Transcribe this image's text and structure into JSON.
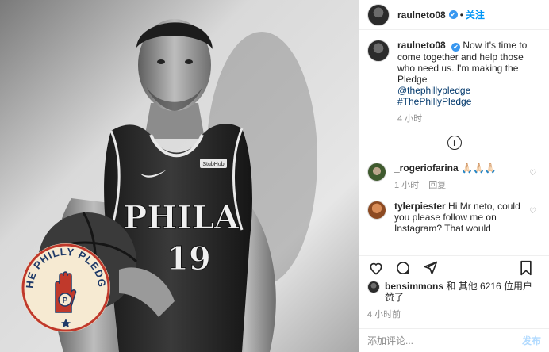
{
  "header": {
    "username": "raulneto08",
    "verified_mark": "✔",
    "separator": "•",
    "follow_label": "关注"
  },
  "caption": {
    "username": "raulneto08",
    "text": "Now it's time to come together and help those who need us. I'm making the Pledge",
    "mention": "@thephillypledge",
    "hashtag": "#ThePhillyPledge",
    "time": "4 小时"
  },
  "comments": [
    {
      "username": "_rogeriofarina",
      "text": "🙏🏻🙏🏻🙏🏻",
      "time": "1 小时",
      "reply_label": "回复"
    },
    {
      "username": "tylerpiester",
      "text": "Hi Mr neto, could you please follow me on Instagram? That would"
    }
  ],
  "likes": {
    "username": "bensimmons",
    "rest": "和 其他 6216 位用户赞了"
  },
  "post_time": "4 小时前",
  "add_comment": {
    "placeholder": "添加评论...",
    "post_label": "发布"
  },
  "photo": {
    "jersey_text": "PHILA",
    "jersey_number": "19",
    "sponsor_patch": "StubHub",
    "badge_text": "THE PHILLY PLEDGE",
    "badge_initial": "P"
  },
  "colors": {
    "link": "#00376b",
    "accent": "#0095f6",
    "verified": "#3897f0",
    "muted": "#8e8e8e"
  },
  "icons": [
    "heart-icon",
    "comment-icon",
    "share-icon",
    "bookmark-icon",
    "add-circle-icon"
  ]
}
